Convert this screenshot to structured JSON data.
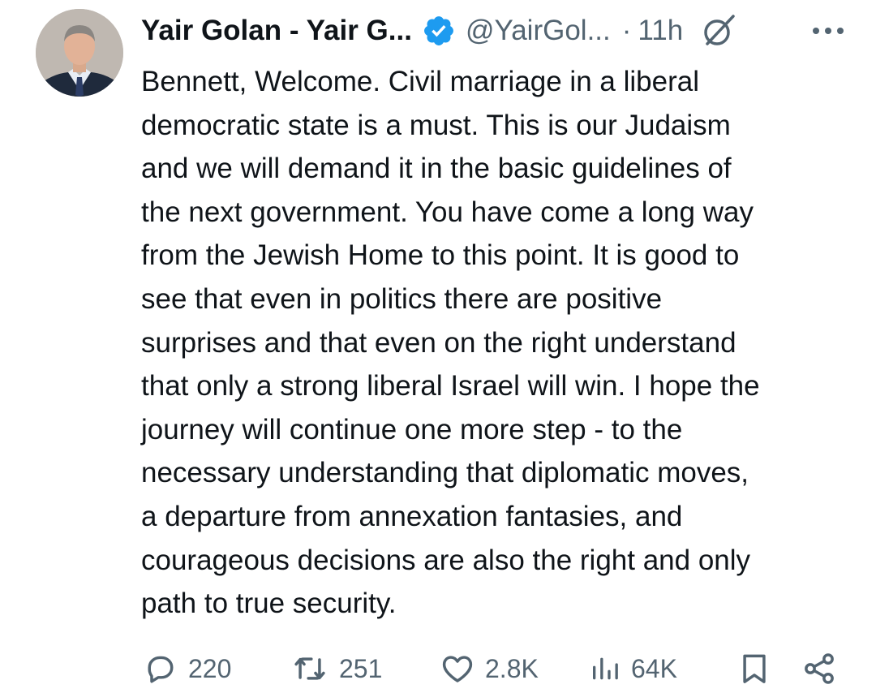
{
  "tweet": {
    "author_name": "Yair Golan - Yair G...",
    "handle": "@YairGol...",
    "separator": "·",
    "time": "11h",
    "text_lines": [
      "Bennett, Welcome. Civil marriage in a liberal",
      "democratic state is a must. This is our Judaism",
      "and we will demand it in the basic guidelines of",
      "the next government. You have come a long way",
      "from the Jewish Home to this point. It is good to",
      "see that even in politics there are positive",
      "surprises and that even on the right understand",
      "that only a strong liberal Israel will win. I hope the",
      "journey will continue one more step - to the",
      "necessary understanding that diplomatic moves,",
      "a departure from annexation fantasies, and",
      "courageous decisions are also the right and only",
      "path to true security."
    ]
  },
  "metrics": {
    "replies": "220",
    "reposts": "251",
    "likes": "2.8K",
    "views": "64K"
  },
  "icons": {
    "verified": "verified-badge-icon",
    "grok": "grok-icon",
    "more": "more-options-icon",
    "reply": "reply-icon",
    "repost": "repost-icon",
    "like": "heart-icon",
    "views": "views-icon",
    "bookmark": "bookmark-icon",
    "share": "share-icon"
  },
  "colors": {
    "text": "#0f1419",
    "secondary": "#536471",
    "verified_blue": "#1d9bf0"
  }
}
